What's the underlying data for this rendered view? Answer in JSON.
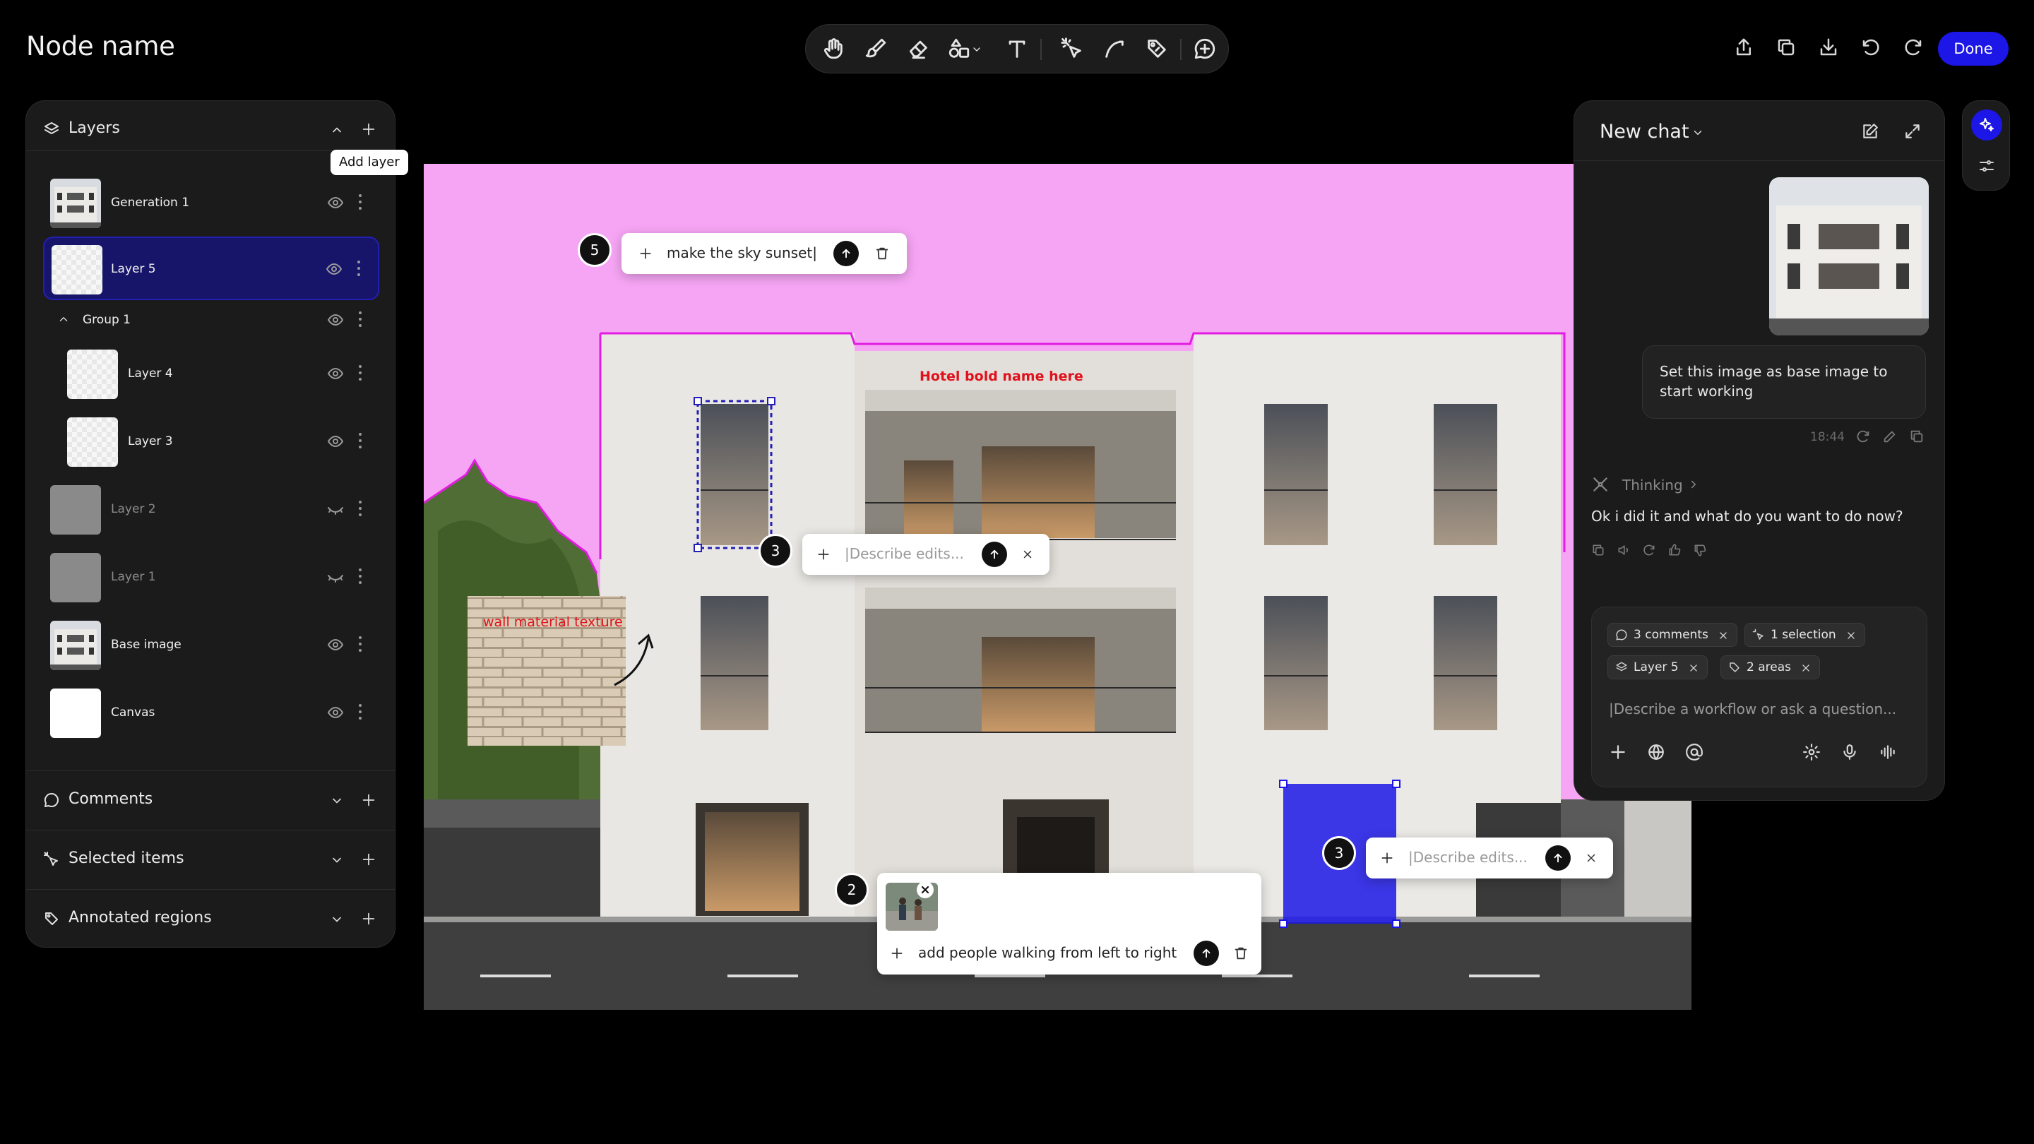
{
  "header": {
    "title": "Node name",
    "done_label": "Done"
  },
  "toolbar": {
    "tools": [
      "hand",
      "brush",
      "eraser",
      "shapes",
      "text",
      "magic-select",
      "lasso",
      "annotate",
      "comment"
    ]
  },
  "layers_panel": {
    "title": "Layers",
    "add_tooltip": "Add layer",
    "items": [
      {
        "name": "Generation 1",
        "visible": true
      },
      {
        "name": "Layer 5",
        "visible": true,
        "selected": true
      },
      {
        "name": "Group 1",
        "visible": true,
        "group": true
      },
      {
        "name": "Layer 4",
        "visible": true
      },
      {
        "name": "Layer 3",
        "visible": true
      },
      {
        "name": "Layer 2",
        "visible": false
      },
      {
        "name": "Layer 1",
        "visible": false
      },
      {
        "name": "Base image",
        "visible": true
      },
      {
        "name": "Canvas",
        "visible": true
      }
    ],
    "sections": [
      "Comments",
      "Selected items",
      "Annotated regions"
    ]
  },
  "canvas": {
    "hotel_label": "Hotel bold name here",
    "wall_label": "wall material texture",
    "colors": {
      "mask": "#f6a5f4",
      "mask_border": "#e21ce0",
      "selection": "#1c16e6",
      "annotation": "#e0111b"
    }
  },
  "comments": [
    {
      "number": "5",
      "text": "make the sky sunset|"
    },
    {
      "number": "3",
      "placeholder": "|Describe edits..."
    },
    {
      "number": "2",
      "text": "add people walking from left to right"
    },
    {
      "number": "3",
      "placeholder": "|Describe edits..."
    }
  ],
  "chat": {
    "title": "New chat",
    "user_message": "Set this image as base image to start working",
    "time": "18:44",
    "thinking_label": "Thinking",
    "assistant_message": "Ok i did it and what do you want to do now?",
    "chips": [
      "3 comments",
      "1 selection",
      "Layer 5",
      "2 areas"
    ],
    "input_placeholder": "|Describe a workflow or ask a question..."
  }
}
